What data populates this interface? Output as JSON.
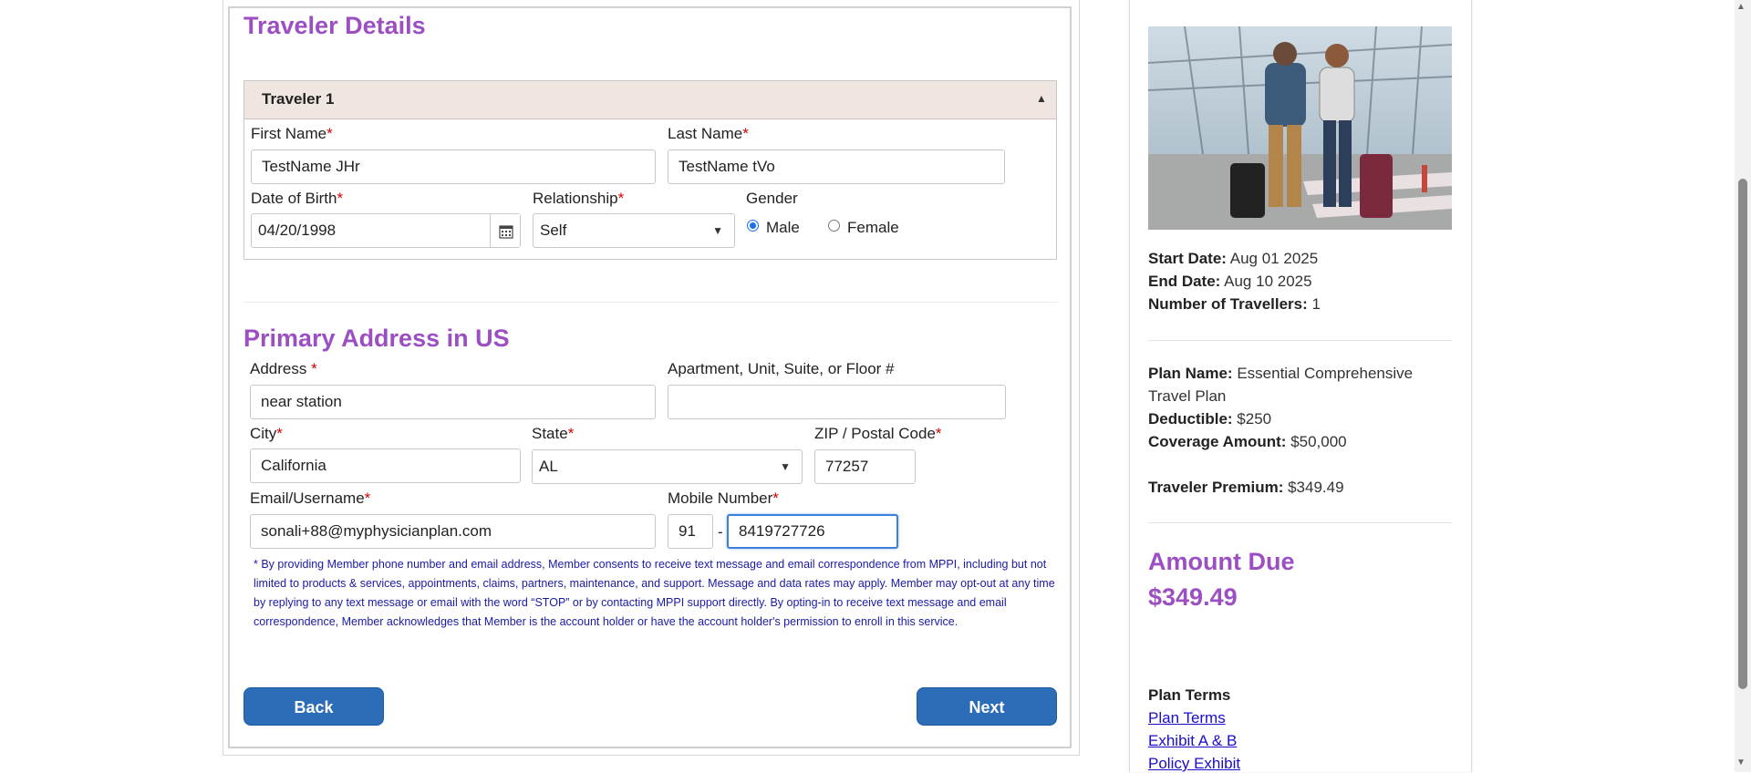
{
  "traveler_section": {
    "title": "Traveler Details",
    "panel_title": "Traveler 1",
    "first_name": {
      "label": "First Name",
      "required": "*",
      "value": "TestName JHr"
    },
    "last_name": {
      "label": "Last Name",
      "required": "*",
      "value": "TestName tVo"
    },
    "dob": {
      "label": "Date of Birth",
      "required": "*",
      "value": "04/20/1998"
    },
    "relationship": {
      "label": "Relationship",
      "required": "*",
      "value": "Self"
    },
    "gender": {
      "label": "Gender",
      "options": [
        "Male",
        "Female"
      ],
      "selected": "Male"
    }
  },
  "address_section": {
    "title": "Primary Address in US",
    "address": {
      "label": "Address ",
      "required": "*",
      "value": "near station"
    },
    "apartment": {
      "label": "Apartment, Unit, Suite, or Floor #",
      "value": ""
    },
    "city": {
      "label": "City",
      "required": "*",
      "value": "California"
    },
    "state": {
      "label": "State",
      "required": "*",
      "value": "AL"
    },
    "zip": {
      "label": "ZIP / Postal Code",
      "required": "*",
      "value": "77257"
    },
    "email": {
      "label": "Email/Username",
      "required": "*",
      "value": "sonali+88@myphysicianplan.com"
    },
    "mobile": {
      "label": "Mobile Number",
      "required": "*",
      "country_code": "91",
      "separator": "-",
      "value": "8419727726"
    },
    "consent_text": "* By providing Member phone number and email address, Member consents to receive text message and email correspondence from MPPI, including but not limited to products & services, appointments, claims, partners, maintenance, and support. Message and data rates may apply. Member may opt-out at any time by replying to any text message or email with the word “STOP” or by contacting MPPI support directly. By opting-in to receive text message and email correspondence, Member acknowledges that Member is the account holder or have the account holder's permission to enroll in this service."
  },
  "buttons": {
    "back": "Back",
    "next": "Next"
  },
  "summary": {
    "start_date": {
      "label": "Start Date:",
      "value": "Aug 01 2025"
    },
    "end_date": {
      "label": "End Date:",
      "value": "Aug 10 2025"
    },
    "travellers": {
      "label": "Number of Travellers:",
      "value": "1"
    },
    "plan_name": {
      "label": "Plan Name:",
      "value_line1": "Essential Comprehensive",
      "value_line2": "Travel Plan"
    },
    "deductible": {
      "label": "Deductible:",
      "value": "$250"
    },
    "coverage": {
      "label": "Coverage Amount:",
      "value": "$50,000"
    },
    "premium": {
      "label": "Traveler Premium:",
      "value": "$349.49"
    },
    "amount_due_label": "Amount Due",
    "amount_due_value": "$349.49",
    "plan_terms_heading": "Plan Terms",
    "links": [
      "Plan Terms",
      "Exhibit A & B",
      "Policy Exhibit"
    ]
  },
  "colors": {
    "accent_purple": "#9b4fc2",
    "button_blue": "#2c6db8",
    "consent_blue": "#1a1aa6",
    "panel_header": "#efe5e1"
  },
  "icons": {
    "calendar": "calendar-icon",
    "collapse": "chevron-up-icon",
    "select_caret": "caret-down-icon"
  }
}
